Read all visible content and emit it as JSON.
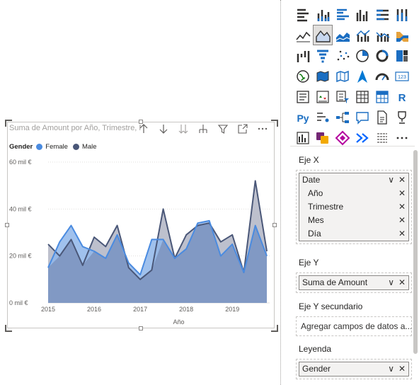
{
  "visual": {
    "title": "Suma de Amount por Año, Trimestre, Mes y Día",
    "legend_title": "Gender",
    "toolbar": [
      "drill-up-icon",
      "drill-down-icon",
      "expand-all-down-icon",
      "expand-hierarchy-icon",
      "filter-icon",
      "focus-mode-icon",
      "more-options-icon"
    ]
  },
  "chart_data": {
    "type": "area",
    "xlabel": "Año",
    "ylabel": "",
    "ylim": [
      0,
      60
    ],
    "y_ticks": [
      "0 mil €",
      "20 mil €",
      "40 mil €",
      "60 mil €"
    ],
    "x_ticks": [
      "2015",
      "2016",
      "2017",
      "2018",
      "2019"
    ],
    "x_start": 2015.0,
    "x_end": 2019.75,
    "grid": true,
    "legend_position": "top-left",
    "series": [
      {
        "name": "Female",
        "color": "#4a8be0",
        "values": [
          15,
          26,
          33,
          24,
          22,
          19,
          29,
          17,
          12,
          27,
          27,
          19,
          23,
          34,
          35,
          20,
          25,
          13,
          33,
          20
        ]
      },
      {
        "name": "Male",
        "color": "#4a5778",
        "values": [
          25,
          20,
          27,
          16,
          28,
          24,
          33,
          15,
          10,
          14,
          40,
          19,
          29,
          33,
          34,
          26,
          29,
          13,
          52,
          22
        ]
      }
    ]
  },
  "pane": {
    "icons": [
      "stacked-bar-icon",
      "stacked-column-icon",
      "clustered-bar-icon",
      "clustered-column-icon",
      "100-stacked-bar-icon",
      "100-stacked-column-icon",
      "line-chart-icon",
      "area-chart-icon",
      "stacked-area-icon",
      "line-clustered-column-icon",
      "line-stacked-column-icon",
      "ribbon-chart-icon",
      "waterfall-icon",
      "funnel-icon",
      "scatter-icon",
      "pie-chart-icon",
      "donut-chart-icon",
      "treemap-icon",
      "map-icon",
      "filled-map-icon",
      "shape-map-icon",
      "azure-map-icon",
      "gauge-icon",
      "card-icon",
      "multi-row-card-icon",
      "kpi-icon",
      "slicer-icon",
      "table-icon",
      "matrix-icon",
      "r-visual-icon",
      "python-visual-icon",
      "key-influencers-icon",
      "decomposition-tree-icon",
      "qa-icon",
      "paginated-report-icon",
      "goals-icon",
      "power-apps-icon",
      "power-automate-icon",
      "appsource-icon",
      "smart-narrative-icon",
      "metrics-icon",
      "more-visuals-icon"
    ],
    "selected_icon": 7,
    "wells": {
      "x_axis": {
        "label": "Eje X",
        "group": "Date",
        "fields": [
          "Año",
          "Trimestre",
          "Mes",
          "Día"
        ]
      },
      "y_axis": {
        "label": "Eje Y",
        "field": "Suma de Amount"
      },
      "secondary_y": {
        "label": "Eje Y secundario",
        "placeholder": "Agregar campos de datos a..."
      },
      "legend": {
        "label": "Leyenda",
        "field": "Gender"
      }
    }
  }
}
